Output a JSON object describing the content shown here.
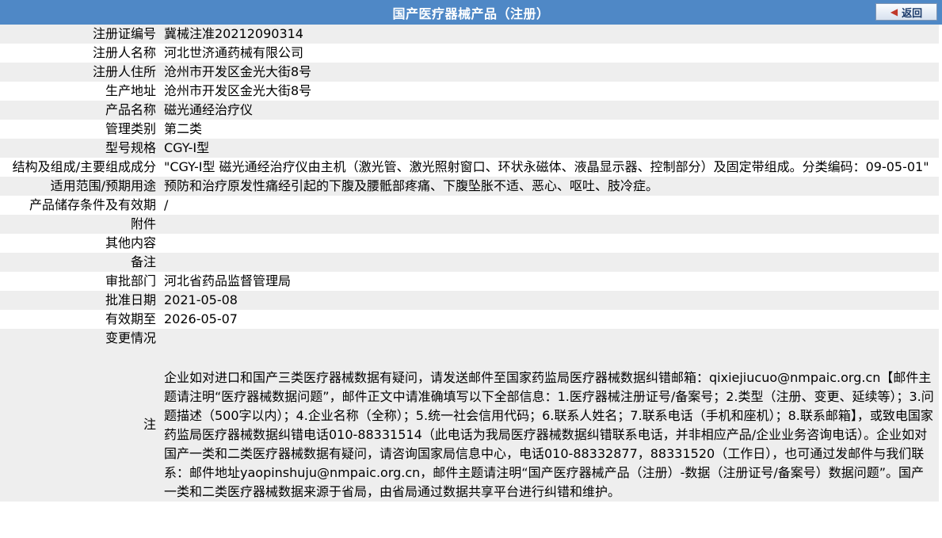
{
  "header": {
    "title": "国产医疗器械产品（注册）",
    "back_label": "返回",
    "back_icon": "back-arrow-icon"
  },
  "rows": [
    {
      "label": "注册证编号",
      "value": "冀械注准20212090314"
    },
    {
      "label": "注册人名称",
      "value": "河北世济通药械有限公司"
    },
    {
      "label": "注册人住所",
      "value": "沧州市开发区金光大街8号"
    },
    {
      "label": "生产地址",
      "value": "沧州市开发区金光大街8号"
    },
    {
      "label": "产品名称",
      "value": "磁光通经治疗仪"
    },
    {
      "label": "管理类别",
      "value": "第二类"
    },
    {
      "label": "型号规格",
      "value": "CGY-Ⅰ型"
    },
    {
      "label": "结构及组成/主要组成成分",
      "value": "\"CGY-Ⅰ型 磁光通经治疗仪由主机（激光管、激光照射窗口、环状永磁体、液晶显示器、控制部分）及固定带组成。分类编码：09-05-01\""
    },
    {
      "label": "适用范围/预期用途",
      "value": "预防和治疗原发性痛经引起的下腹及腰骶部疼痛、下腹坠胀不适、恶心、呕吐、肢冷症。"
    },
    {
      "label": "产品储存条件及有效期",
      "value": "/"
    },
    {
      "label": "附件",
      "value": ""
    },
    {
      "label": "其他内容",
      "value": ""
    },
    {
      "label": "备注",
      "value": ""
    },
    {
      "label": "审批部门",
      "value": "河北省药品监督管理局"
    },
    {
      "label": "批准日期",
      "value": "2021-05-08"
    },
    {
      "label": "有效期至",
      "value": "2026-05-07"
    },
    {
      "label": "变更情况",
      "value": ""
    }
  ],
  "note": {
    "label": "注",
    "text": "企业如对进口和国产三类医疗器械数据有疑问，请发送邮件至国家药监局医疗器械数据纠错邮箱：qixiejiucuo@nmpaic.org.cn【邮件主题请注明“医疗器械数据问题”，邮件正文中请准确填写以下全部信息：1.医疗器械注册证号/备案号；2.类型（注册、变更、延续等）；3.问题描述（500字以内）；4.企业名称（全称）；5.统一社会信用代码；6.联系人姓名；7.联系电话（手机和座机）；8.联系邮箱】，或致电国家药监局医疗器械数据纠错电话010-88331514（此电话为我局医疗器械数据纠错联系电话，并非相应产品/企业业务咨询电话）。企业如对国产一类和二类医疗器械数据有疑问，请咨询国家局信息中心，电话010-88332877，88331520（工作日），也可通过发邮件与我们联系：邮件地址yaopinshuju@nmpaic.org.cn，邮件主题请注明“国产医疗器械产品（注册）-数据（注册证号/备案号）数据问题”。国产一类和二类医疗器械数据来源于省局，由省局通过数据共享平台进行纠错和维护。"
  },
  "colors": {
    "header_bg": "#4f88c6",
    "row_alt_bg": "#eeeeee",
    "row_bg": "#ffffff"
  }
}
